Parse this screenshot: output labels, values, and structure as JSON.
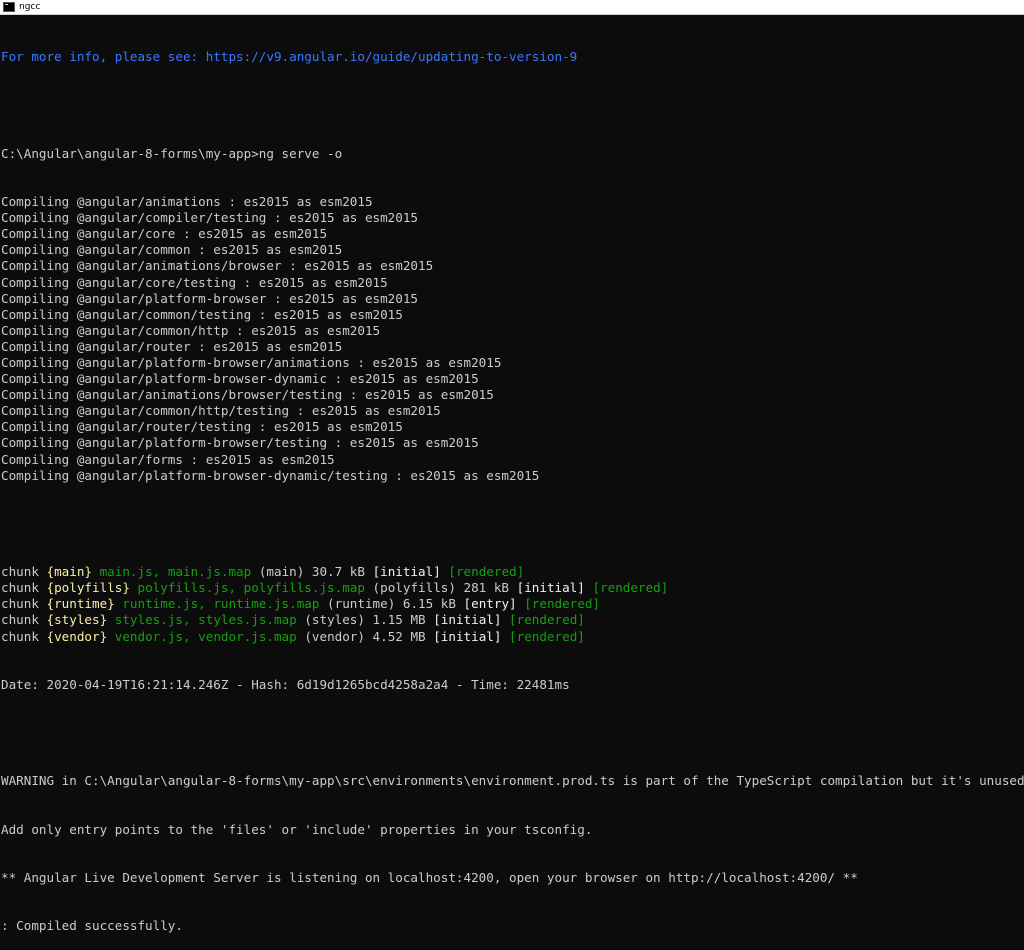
{
  "window": {
    "title": "ngcc",
    "icon": "console-icon"
  },
  "colors": {
    "background": "#0c0c0c",
    "text": "#cccccc",
    "info": "#3b78ff",
    "chunk_name": "#f9f1a5",
    "chunk_files": "#13a10e",
    "bright": "#f2f2f2"
  },
  "terminal": {
    "info_line": "For more info, please see: https://v9.angular.io/guide/updating-to-version-9",
    "prompt": "C:\\Angular\\angular-8-forms\\my-app>ng serve -o",
    "compiling": [
      "Compiling @angular/animations : es2015 as esm2015",
      "Compiling @angular/compiler/testing : es2015 as esm2015",
      "Compiling @angular/core : es2015 as esm2015",
      "Compiling @angular/common : es2015 as esm2015",
      "Compiling @angular/animations/browser : es2015 as esm2015",
      "Compiling @angular/core/testing : es2015 as esm2015",
      "Compiling @angular/platform-browser : es2015 as esm2015",
      "Compiling @angular/common/testing : es2015 as esm2015",
      "Compiling @angular/common/http : es2015 as esm2015",
      "Compiling @angular/router : es2015 as esm2015",
      "Compiling @angular/platform-browser/animations : es2015 as esm2015",
      "Compiling @angular/platform-browser-dynamic : es2015 as esm2015",
      "Compiling @angular/animations/browser/testing : es2015 as esm2015",
      "Compiling @angular/common/http/testing : es2015 as esm2015",
      "Compiling @angular/router/testing : es2015 as esm2015",
      "Compiling @angular/platform-browser/testing : es2015 as esm2015",
      "Compiling @angular/forms : es2015 as esm2015",
      "Compiling @angular/platform-browser-dynamic/testing : es2015 as esm2015"
    ],
    "chunks": [
      {
        "prefix": "chunk ",
        "name": "{main}",
        "files": " main.js, main.js.map",
        "info": " (main) 30.7 kB ",
        "tag": "[initial]",
        "status": " [rendered]"
      },
      {
        "prefix": "chunk ",
        "name": "{polyfills}",
        "files": " polyfills.js, polyfills.js.map",
        "info": " (polyfills) 281 kB ",
        "tag": "[initial]",
        "status": " [rendered]"
      },
      {
        "prefix": "chunk ",
        "name": "{runtime}",
        "files": " runtime.js, runtime.js.map",
        "info": " (runtime) 6.15 kB ",
        "tag": "[entry]",
        "status": " [rendered]"
      },
      {
        "prefix": "chunk ",
        "name": "{styles}",
        "files": " styles.js, styles.js.map",
        "info": " (styles) 1.15 MB ",
        "tag": "[initial]",
        "status": " [rendered]"
      },
      {
        "prefix": "chunk ",
        "name": "{vendor}",
        "files": " vendor.js, vendor.js.map",
        "info": " (vendor) 4.52 MB ",
        "tag": "[initial]",
        "status": " [rendered]"
      }
    ],
    "date_line": "Date: 2020-04-19T16:21:14.246Z - Hash: 6d19d1265bcd4258a2a4 - Time: 22481ms",
    "warning_1": "WARNING in C:\\Angular\\angular-8-forms\\my-app\\src\\environments\\environment.prod.ts is part of the TypeScript compilation but it's unused.",
    "warning_2": "Add only entry points to the 'files' or 'include' properties in your tsconfig.",
    "server_line": "** Angular Live Development Server is listening on localhost:4200, open your browser on http://localhost:4200/ **",
    "compiled_line": ": Compiled successfully."
  }
}
